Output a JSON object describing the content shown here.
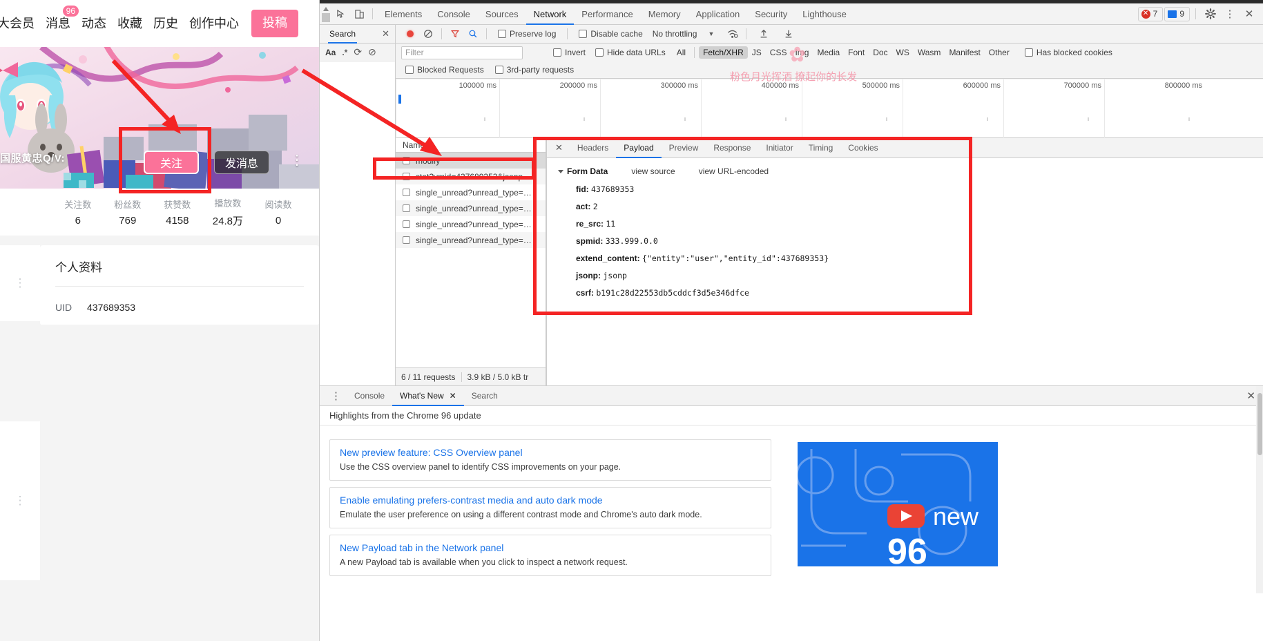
{
  "page": {
    "nav": [
      {
        "label": "大会员",
        "badge": null
      },
      {
        "label": "消息",
        "badge": "96"
      },
      {
        "label": "动态",
        "badge": null
      },
      {
        "label": "收藏",
        "badge": null
      },
      {
        "label": "历史",
        "badge": null
      },
      {
        "label": "创作中心",
        "badge": null
      }
    ],
    "post_button": "投稿",
    "banner_username": "国服黄忠Q/V:",
    "follow_button": "关注",
    "message_button": "发消息",
    "more_icon": "⋮",
    "stats": [
      {
        "label": "关注数",
        "value": "6"
      },
      {
        "label": "粉丝数",
        "value": "769"
      },
      {
        "label": "获赞数",
        "value": "4158"
      },
      {
        "label": "播放数",
        "value": "24.8万"
      },
      {
        "label": "阅读数",
        "value": "0"
      }
    ],
    "profile": {
      "title": "个人资料",
      "uid_label": "UID",
      "uid_value": "437689353"
    },
    "rail_icon": "⋮"
  },
  "devtools": {
    "main_tabs": [
      {
        "label": "Elements",
        "active": false
      },
      {
        "label": "Console",
        "active": false
      },
      {
        "label": "Sources",
        "active": false
      },
      {
        "label": "Network",
        "active": true
      },
      {
        "label": "Performance",
        "active": false
      },
      {
        "label": "Memory",
        "active": false
      },
      {
        "label": "Application",
        "active": false
      },
      {
        "label": "Security",
        "active": false
      },
      {
        "label": "Lighthouse",
        "active": false
      }
    ],
    "error_count": "7",
    "message_count": "9",
    "settings_icon": "gear-icon",
    "more_icon": "⋮",
    "close_icon": "✕",
    "inspect_icon": "inspect-element-icon",
    "device_icon": "device-toolbar-icon",
    "search_pane": {
      "tab": "Search",
      "close": "✕",
      "match_case": "Aa",
      "regex": ".*",
      "refresh": "⟳",
      "clear": "⊘"
    },
    "network_toolbar": {
      "record_icon": "record-icon",
      "clear_icon": "clear-icon",
      "filter_icon": "filter-icon",
      "search_icon": "search-icon",
      "preserve_log": "Preserve log",
      "disable_cache": "Disable cache",
      "throttling": "No throttling",
      "throttling_caret": "▼",
      "wifi_icon": "network-conditions-icon",
      "import_icon": "import-har-icon",
      "export_icon": "export-har-icon"
    },
    "filter_row": {
      "filter_placeholder": "Filter",
      "filter_value": "",
      "invert": "Invert",
      "hide_data_urls": "Hide data URLs",
      "types": [
        {
          "label": "All",
          "active": false
        },
        {
          "label": "Fetch/XHR",
          "active": true
        },
        {
          "label": "JS",
          "active": false
        },
        {
          "label": "CSS",
          "active": false
        },
        {
          "label": "Img",
          "active": false
        },
        {
          "label": "Media",
          "active": false
        },
        {
          "label": "Font",
          "active": false
        },
        {
          "label": "Doc",
          "active": false
        },
        {
          "label": "WS",
          "active": false
        },
        {
          "label": "Wasm",
          "active": false
        },
        {
          "label": "Manifest",
          "active": false
        },
        {
          "label": "Other",
          "active": false
        }
      ],
      "has_blocked_cookies": "Has blocked cookies",
      "blocked_requests": "Blocked Requests",
      "third_party_requests": "3rd-party requests"
    },
    "timeline": {
      "ticks": [
        "100000 ms",
        "200000 ms",
        "300000 ms",
        "400000 ms",
        "500000 ms",
        "600000 ms",
        "700000 ms",
        "800000 ms"
      ]
    },
    "request_table": {
      "header": "Name",
      "rows": [
        {
          "name": "modify",
          "selected": true
        },
        {
          "name": "stat?vmid=437689353&jsonp..",
          "selected": false
        },
        {
          "name": "single_unread?unread_type=…",
          "selected": false
        },
        {
          "name": "single_unread?unread_type=…",
          "selected": false
        },
        {
          "name": "single_unread?unread_type=…",
          "selected": false
        },
        {
          "name": "single_unread?unread_type=…",
          "selected": false
        }
      ]
    },
    "status_bar": {
      "requests": "6 / 11 requests",
      "transferred": "3.9 kB / 5.0 kB tr"
    },
    "details": {
      "close": "✕",
      "tabs": [
        {
          "label": "Headers",
          "active": false
        },
        {
          "label": "Payload",
          "active": true
        },
        {
          "label": "Preview",
          "active": false
        },
        {
          "label": "Response",
          "active": false
        },
        {
          "label": "Initiator",
          "active": false
        },
        {
          "label": "Timing",
          "active": false
        },
        {
          "label": "Cookies",
          "active": false
        }
      ],
      "form_data_title": "Form Data",
      "view_source": "view source",
      "view_url_encoded": "view URL-encoded",
      "fields": [
        {
          "key": "fid:",
          "value": "437689353"
        },
        {
          "key": "act:",
          "value": "2"
        },
        {
          "key": "re_src:",
          "value": "11"
        },
        {
          "key": "spmid:",
          "value": "333.999.0.0"
        },
        {
          "key": "extend_content:",
          "value": "{\"entity\":\"user\",\"entity_id\":437689353}"
        },
        {
          "key": "jsonp:",
          "value": "jsonp"
        },
        {
          "key": "csrf:",
          "value": "b191c28d22553db5cddcf3d5e346dfce"
        }
      ]
    },
    "drawer": {
      "menu_icon": "⋮",
      "tabs": [
        {
          "label": "Console",
          "active": false,
          "closable": false
        },
        {
          "label": "What's New",
          "active": true,
          "closable": true
        },
        {
          "label": "Search",
          "active": false,
          "closable": false
        }
      ],
      "close": "✕",
      "heading": "Highlights from the Chrome 96 update",
      "items": [
        {
          "title": "New preview feature: CSS Overview panel",
          "desc": "Use the CSS overview panel to identify CSS improvements on your page."
        },
        {
          "title": "Enable emulating prefers-contrast media and auto dark mode",
          "desc": "Emulate the user preference on using a different contrast mode and Chrome's auto dark mode."
        },
        {
          "title": "New Payload tab in the Network panel",
          "desc": "A new Payload tab is available when you click to inspect a network request."
        }
      ],
      "promo_text": "new",
      "promo_number": "96"
    }
  },
  "watermarks": {
    "text": "粉色月光挥洒 撩起你的长发",
    "color": "#f58ea3"
  },
  "annotations": {
    "color": "#f42424",
    "boxes": [
      "follow-button-highlight",
      "modify-request-highlight",
      "payload-panel-highlight"
    ],
    "arrows": [
      "arrow-to-follow-button",
      "arrow-to-modify-request"
    ]
  }
}
